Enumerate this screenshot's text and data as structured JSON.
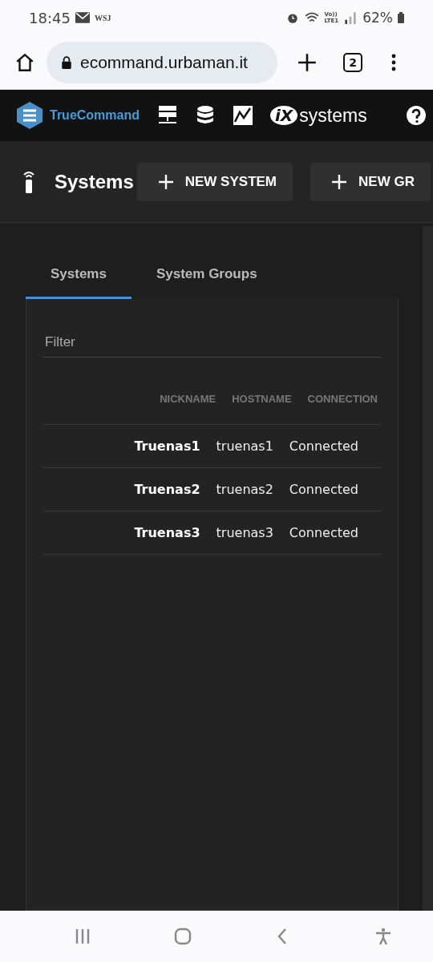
{
  "status_bar": {
    "time": "18:45",
    "news_label": "WSJ",
    "volte": "Vo))",
    "lte": "LTE1",
    "battery": "62%"
  },
  "browser": {
    "url": "ecommand.urbaman.it",
    "tab_count": "2"
  },
  "app_header": {
    "brand": "TrueCommand",
    "vendor_mark": "iX",
    "vendor_word": "systems"
  },
  "page": {
    "title": "Systems",
    "actions": [
      "NEW SYSTEM",
      "NEW GR"
    ]
  },
  "tabs": [
    {
      "label": "Systems",
      "selected": true
    },
    {
      "label": "System Groups",
      "selected": false
    }
  ],
  "filter": {
    "placeholder": "Filter"
  },
  "table": {
    "columns": [
      "NICKNAME",
      "HOSTNAME",
      "CONNECTION"
    ],
    "rows": [
      {
        "nickname": "Truenas1",
        "hostname": "truenas1",
        "connection": "Connected"
      },
      {
        "nickname": "Truenas2",
        "hostname": "truenas2",
        "connection": "Connected"
      },
      {
        "nickname": "Truenas3",
        "hostname": "truenas3",
        "connection": "Connected"
      }
    ]
  }
}
